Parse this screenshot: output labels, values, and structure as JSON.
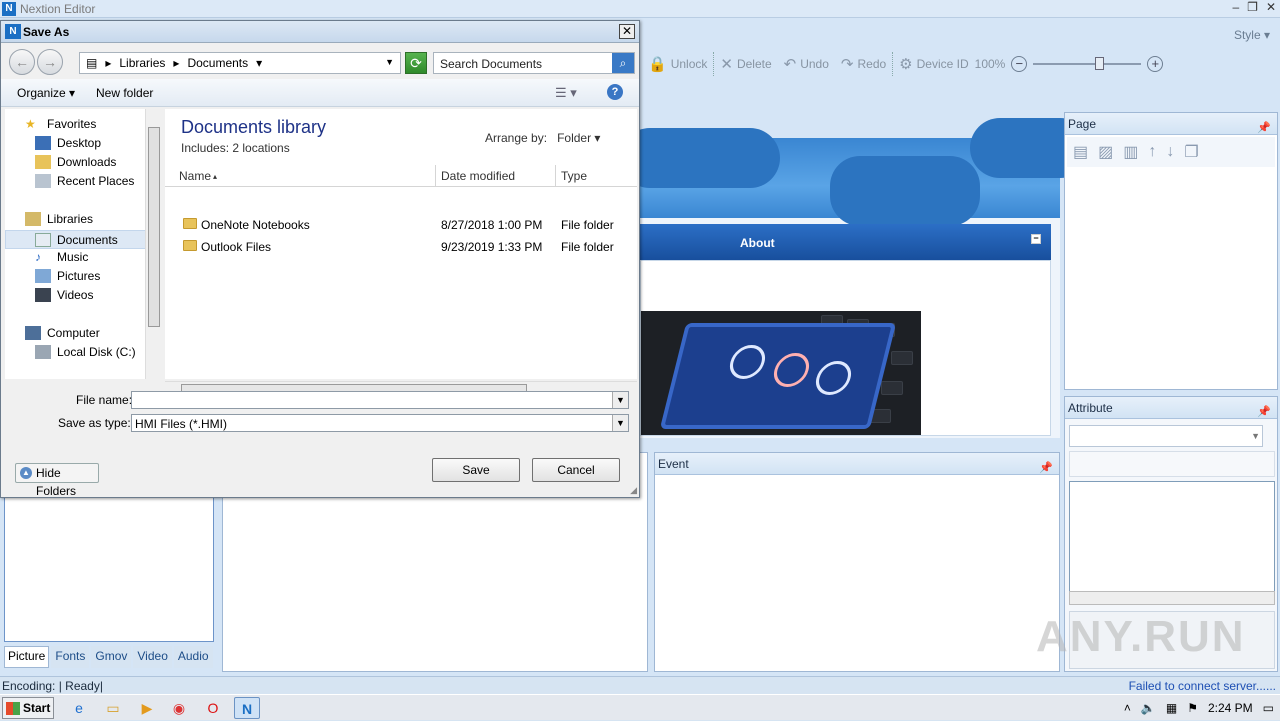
{
  "app": {
    "title": "Nextion Editor",
    "style_label": "Style",
    "window_controls": [
      "–",
      "❐",
      "✕"
    ]
  },
  "toolbar": {
    "unlock": "Unlock",
    "delete": "Delete",
    "undo": "Undo",
    "redo": "Redo",
    "device_id": "Device ID",
    "zoom": "100%"
  },
  "canvas": {
    "about_title": "About"
  },
  "panels": {
    "page_title": "Page",
    "attribute_title": "Attribute",
    "event_title": "Event"
  },
  "left_tabs": [
    "Picture",
    "Fonts",
    "Gmov",
    "Video",
    "Audio"
  ],
  "status": {
    "left": "Encoding: | Ready|",
    "right": "Failed to connect server......"
  },
  "taskbar": {
    "start": "Start",
    "clock": "2:24 PM"
  },
  "watermark": "ANY.RUN",
  "dialog": {
    "title": "Save As",
    "address": [
      "Libraries",
      "Documents"
    ],
    "search_placeholder": "Search Documents",
    "organize": "Organize",
    "new_folder": "New folder",
    "nav": {
      "favorites": "Favorites",
      "desktop": "Desktop",
      "downloads": "Downloads",
      "recent_places": "Recent Places",
      "libraries": "Libraries",
      "documents": "Documents",
      "music": "Music",
      "pictures": "Pictures",
      "videos": "Videos",
      "computer": "Computer",
      "local_disk": "Local Disk (C:)"
    },
    "library_title": "Documents library",
    "library_sub": "Includes:  2 locations",
    "arrange_by_label": "Arrange by:",
    "arrange_by_value": "Folder",
    "columns": [
      "Name",
      "Date modified",
      "Type"
    ],
    "files": [
      {
        "name": "OneNote Notebooks",
        "date": "8/27/2018 1:00 PM",
        "type": "File folder"
      },
      {
        "name": "Outlook Files",
        "date": "9/23/2019 1:33 PM",
        "type": "File folder"
      }
    ],
    "file_name_label": "File name:",
    "file_name_value": "",
    "save_type_label": "Save as type:",
    "save_type_value": "HMI Files (*.HMI)",
    "hide_folders": "Hide Folders",
    "save": "Save",
    "cancel": "Cancel"
  }
}
